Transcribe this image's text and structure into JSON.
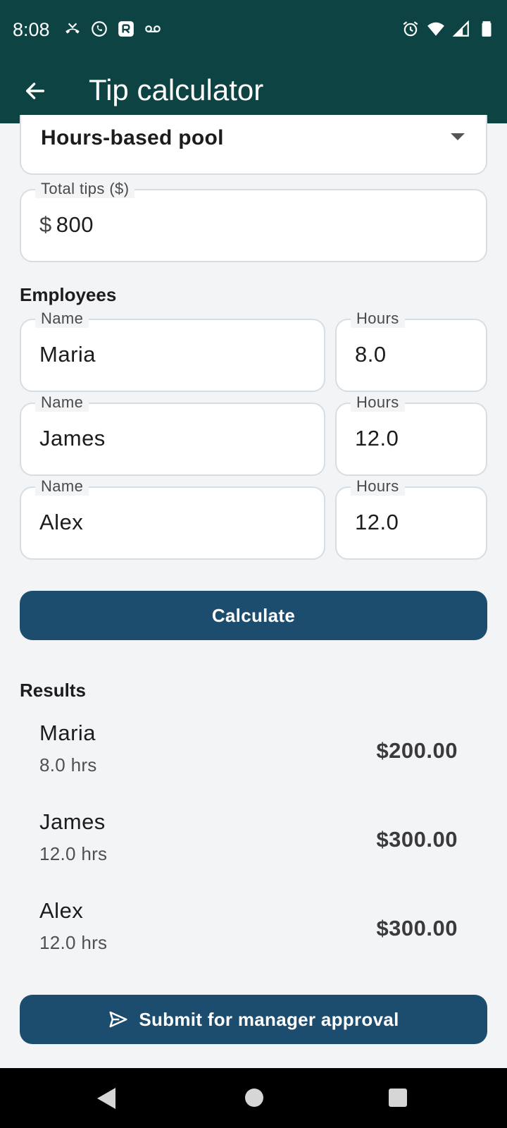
{
  "status_bar": {
    "time": "8:08",
    "left_icons": [
      "missed-call-icon",
      "whatsapp-icon",
      "app-badge-icon",
      "voicemail-icon"
    ],
    "right_icons": [
      "alarm-icon",
      "wifi-icon",
      "signal-icon",
      "battery-icon"
    ]
  },
  "app_bar": {
    "title": "Tip calculator",
    "back_icon": "arrow-back-icon"
  },
  "form": {
    "split_method": "Hours-based pool",
    "total_tips_label": "Total tips ($)",
    "total_tips_prefix": "$",
    "total_tips_value": "800"
  },
  "employees": {
    "heading": "Employees",
    "name_label": "Name",
    "hours_label": "Hours",
    "rows": [
      {
        "name": "Maria",
        "hours": "8.0"
      },
      {
        "name": "James",
        "hours": "12.0"
      },
      {
        "name": "Alex",
        "hours": "12.0"
      }
    ]
  },
  "calculate_label": "Calculate",
  "results": {
    "heading": "Results",
    "rows": [
      {
        "name": "Maria",
        "hours": "8.0 hrs",
        "amount": "$200.00"
      },
      {
        "name": "James",
        "hours": "12.0 hrs",
        "amount": "$300.00"
      },
      {
        "name": "Alex",
        "hours": "12.0 hrs",
        "amount": "$300.00"
      }
    ]
  },
  "submit": {
    "label": "Submit for manager approval",
    "icon": "send-icon"
  },
  "colors": {
    "app_bar": "#0d4342",
    "primary_button": "#1c4d6e",
    "background": "#f3f4f6"
  }
}
